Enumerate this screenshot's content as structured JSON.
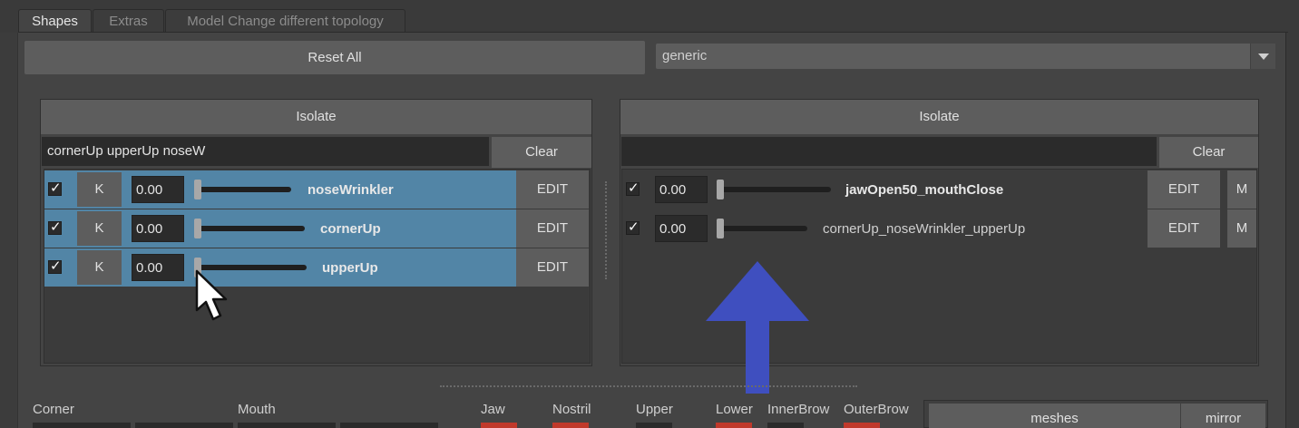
{
  "tabs": [
    {
      "label": "Shapes",
      "active": true
    },
    {
      "label": "Extras",
      "active": false
    },
    {
      "label": "Model Change different topology",
      "active": false
    }
  ],
  "toolbar": {
    "reset_label": "Reset All",
    "preset_value": "generic"
  },
  "left_panel": {
    "isolate_label": "Isolate",
    "filter_value": "cornerUp upperUp noseW",
    "clear_label": "Clear",
    "rows": [
      {
        "checked": true,
        "key_label": "K",
        "value": "0.00",
        "name": "noseWrinkler",
        "edit_label": "EDIT",
        "selected": true
      },
      {
        "checked": true,
        "key_label": "K",
        "value": "0.00",
        "name": "cornerUp",
        "edit_label": "EDIT",
        "selected": true
      },
      {
        "checked": true,
        "key_label": "K",
        "value": "0.00",
        "name": "upperUp",
        "edit_label": "EDIT",
        "selected": true
      }
    ]
  },
  "right_panel": {
    "isolate_label": "Isolate",
    "filter_value": "",
    "clear_label": "Clear",
    "rows": [
      {
        "checked": true,
        "value": "0.00",
        "name": "jawOpen50_mouthClose",
        "edit_label": "EDIT",
        "m_label": "M"
      },
      {
        "checked": true,
        "value": "0.00",
        "name": "cornerUp_noseWrinkler_upperUp",
        "edit_label": "EDIT",
        "m_label": "M"
      }
    ]
  },
  "bottom": {
    "labels": {
      "corner": "Corner",
      "mouth": "Mouth",
      "jaw": "Jaw",
      "nostril": "Nostril",
      "upper": "Upper",
      "lower": "Lower",
      "innerbrow": "InnerBrow",
      "outerbrow": "OuterBrow"
    },
    "meshes_label": "meshes",
    "mirror_label": "mirror"
  },
  "colors": {
    "selection": "#5285a6",
    "annotation_arrow": "#3f4fbf",
    "swatch_red": "#c0392b"
  }
}
